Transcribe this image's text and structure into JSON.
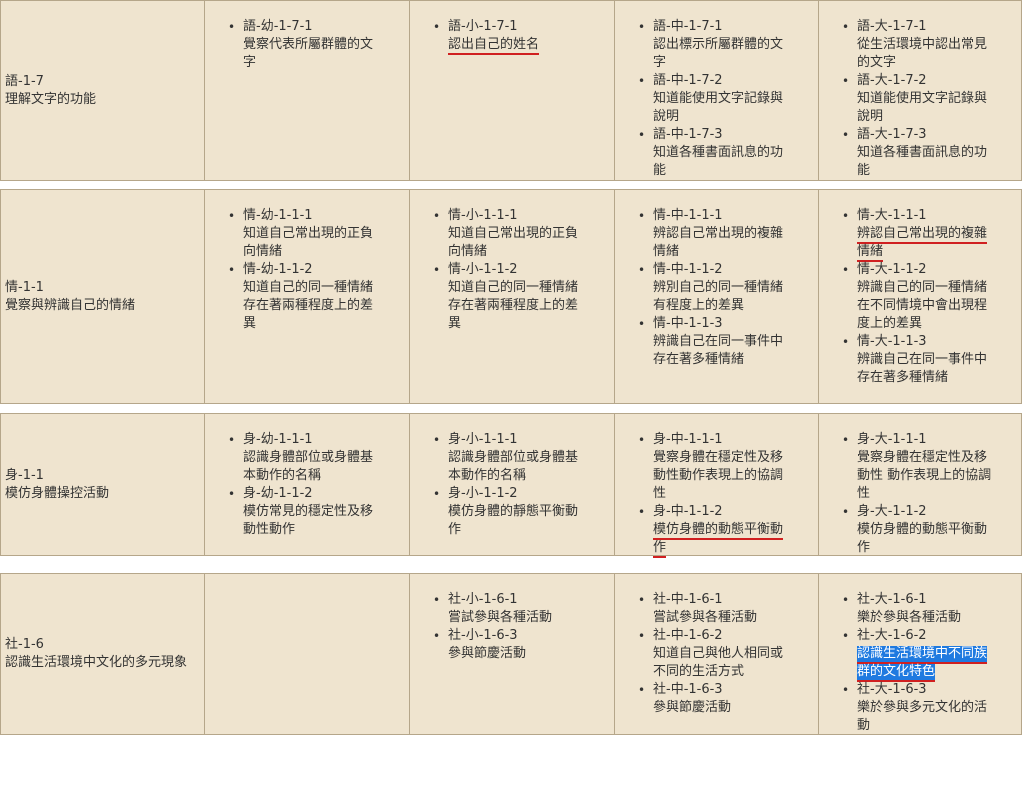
{
  "rows": [
    {
      "label_code": "語-1-7",
      "label_desc": "理解文字的功能",
      "cols": [
        [
          {
            "code": "語-幼-1-7-1",
            "desc": "覺察代表所屬群體的文字"
          }
        ],
        [
          {
            "code": "語-小-1-7-1",
            "desc": "認出自己的姓名"
          }
        ],
        [
          {
            "code": "語-中-1-7-1",
            "desc": "認出標示所屬群體的文字"
          },
          {
            "code": "語-中-1-7-2",
            "desc": "知道能使用文字記錄與說明"
          },
          {
            "code": "語-中-1-7-3",
            "desc": "知道各種書面訊息的功能"
          }
        ],
        [
          {
            "code": "語-大-1-7-1",
            "desc": "從生活環境中認出常見的文字"
          },
          {
            "code": "語-大-1-7-2",
            "desc": "知道能使用文字記錄與說明"
          },
          {
            "code": "語-大-1-7-3",
            "desc": "知道各種書面訊息的功能"
          }
        ]
      ]
    },
    {
      "label_code": "情-1-1",
      "label_desc": "覺察與辨識自己的情緒",
      "cols": [
        [
          {
            "code": "情-幼-1-1-1",
            "desc": "知道自己常出現的正負向情緒"
          },
          {
            "code": "情-幼-1-1-2",
            "desc": "知道自己的同一種情緒存在著兩種程度上的差異"
          }
        ],
        [
          {
            "code": "情-小-1-1-1",
            "desc": "知道自己常出現的正負向情緒"
          },
          {
            "code": "情-小-1-1-2",
            "desc": "知道自己的同一種情緒存在著兩種程度上的差異"
          }
        ],
        [
          {
            "code": "情-中-1-1-1",
            "desc": "辨認自己常出現的複雜情緒"
          },
          {
            "code": "情-中-1-1-2",
            "desc": "辨別自己的同一種情緒有程度上的差異"
          },
          {
            "code": "情-中-1-1-3",
            "desc": "辨識自己在同一事件中存在著多種情緒"
          }
        ],
        [
          {
            "code": "情-大-1-1-1",
            "desc": "辨認自己常出現的複雜情緒"
          },
          {
            "code": "情-大-1-1-2",
            "desc": "辨識自己的同一種情緒在不同情境中會出現程度上的差異"
          },
          {
            "code": "情-大-1-1-3",
            "desc": "辨識自己在同一事件中存在著多種情緒"
          }
        ]
      ]
    },
    {
      "label_code": "身-1-1",
      "label_desc": "模仿身體操控活動",
      "cols": [
        [
          {
            "code": "身-幼-1-1-1",
            "desc": "認識身體部位或身體基本動作的名稱"
          },
          {
            "code": "身-幼-1-1-2",
            "desc": "模仿常見的穩定性及移動性動作"
          }
        ],
        [
          {
            "code": "身-小-1-1-1",
            "desc": "認識身體部位或身體基本動作的名稱"
          },
          {
            "code": "身-小-1-1-2",
            "desc": "模仿身體的靜態平衡動作"
          }
        ],
        [
          {
            "code": "身-中-1-1-1",
            "desc": "覺察身體在穩定性及移動性動作表現上的協調性"
          },
          {
            "code": "身-中-1-1-2",
            "desc": "模仿身體的動態平衡動作"
          }
        ],
        [
          {
            "code": "身-大-1-1-1",
            "desc": "覺察身體在穩定性及移動性 動作表現上的協調性"
          },
          {
            "code": "身-大-1-1-2",
            "desc": "模仿身體的動態平衡動作"
          }
        ]
      ]
    },
    {
      "label_code": "社-1-6",
      "label_desc": "認識生活環境中文化的多元現象",
      "cols": [
        [],
        [
          {
            "code": "社-小-1-6-1",
            "desc": "嘗試參與各種活動"
          },
          {
            "code": "社-小-1-6-3",
            "desc": "參與節慶活動"
          }
        ],
        [
          {
            "code": "社-中-1-6-1",
            "desc": "嘗試參與各種活動"
          },
          {
            "code": "社-中-1-6-2",
            "desc": "知道自己與他人相同或不同的生活方式"
          },
          {
            "code": "社-中-1-6-3",
            "desc": "參與節慶活動"
          }
        ],
        [
          {
            "code": "社-大-1-6-1",
            "desc": "樂於參與各種活動"
          },
          {
            "code": "社-大-1-6-2",
            "desc": "認識生活環境中不同族群的文化特色"
          },
          {
            "code": "社-大-1-6-3",
            "desc": "樂於參與多元文化的活動"
          }
        ]
      ]
    }
  ]
}
